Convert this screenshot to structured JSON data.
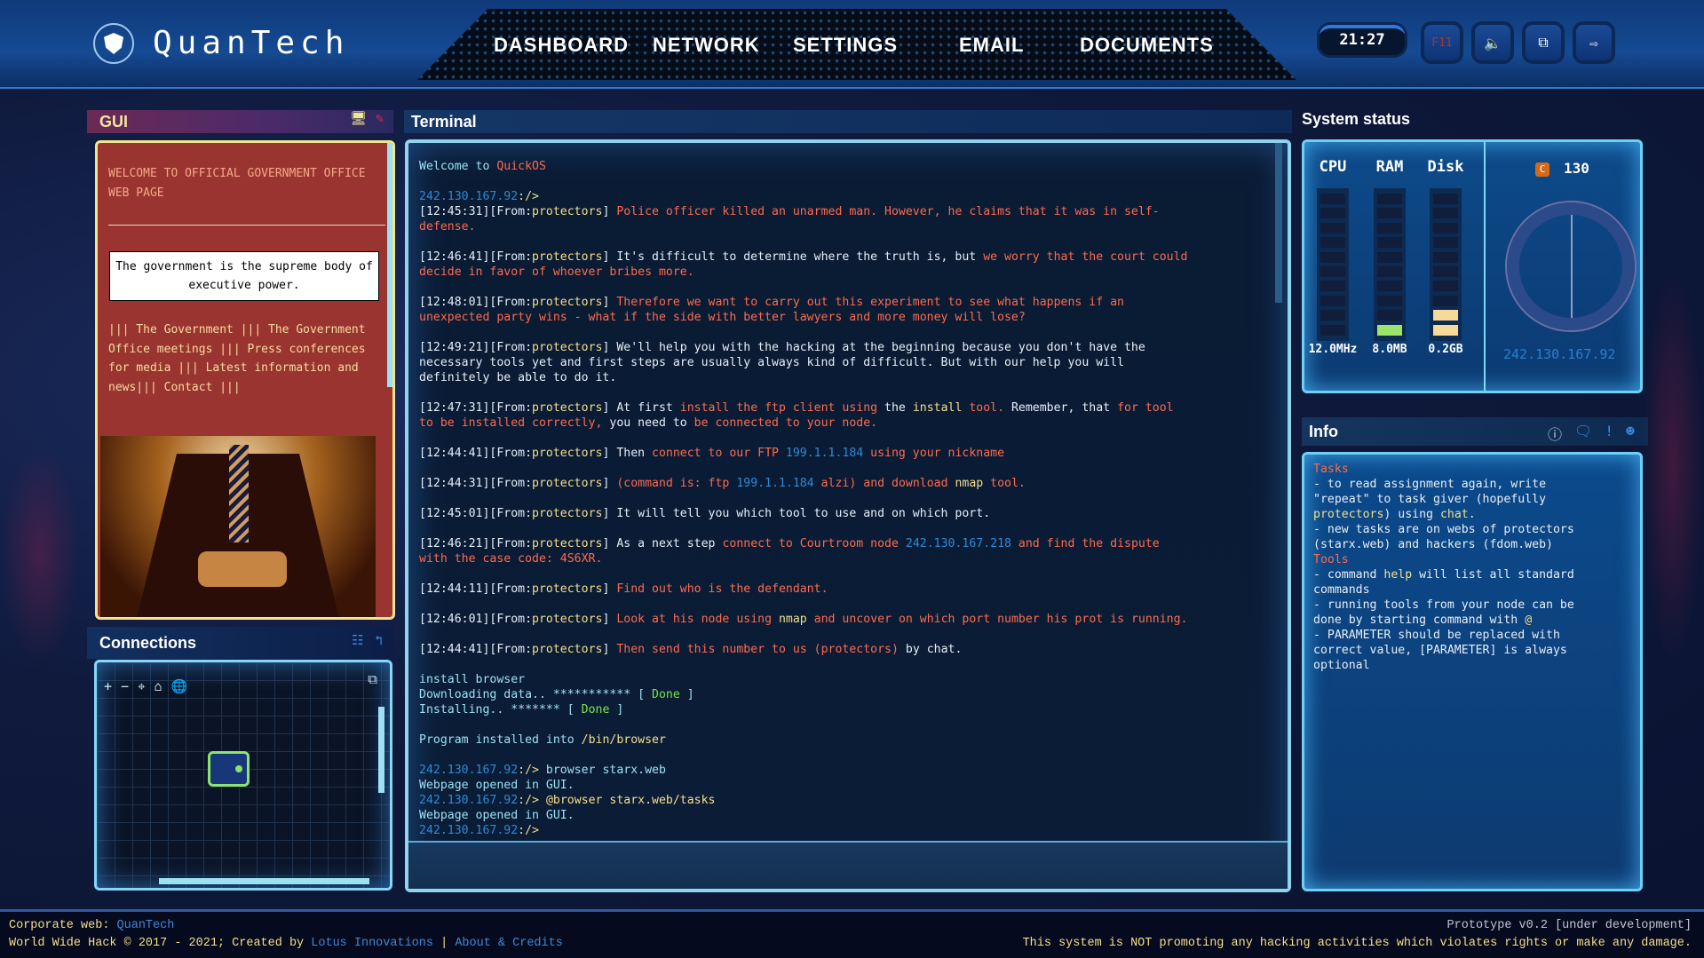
{
  "header": {
    "brand": "QuanTech",
    "nav": [
      "DASHBOARD",
      "NETWORK",
      "SETTINGS",
      "EMAIL",
      "DOCUMENTS"
    ],
    "clock": "21:27",
    "buttons": [
      {
        "name": "fullscreen",
        "label": "F11",
        "icon": "f11-key",
        "color": "#c23a2a"
      },
      {
        "name": "sound",
        "label": "",
        "icon": "speaker-icon"
      },
      {
        "name": "window",
        "label": "",
        "icon": "window-cursor-icon"
      },
      {
        "name": "logout",
        "label": "",
        "icon": "logout-icon"
      }
    ]
  },
  "gui": {
    "title": "GUI",
    "icons": [
      "monitor-icon",
      "edit-icon"
    ],
    "heading": "WELCOME TO OFFICIAL GOVERNMENT OFFICE WEB PAGE",
    "quote": "The government is the supreme body of executive power.",
    "links": "||| The Government ||| The Government Office meetings ||| Press conferences for media ||| Latest information and news||| Contact |||"
  },
  "connections": {
    "title": "Connections",
    "header_icons": [
      "network-tree-icon",
      "route-icon"
    ],
    "toolbar": [
      "+",
      "−",
      "locate-icon",
      "home-icon",
      "globe-icon"
    ],
    "expand_icon": "external-link-icon"
  },
  "terminal": {
    "title": "Terminal",
    "lines": [
      [
        [
          "c",
          "Welcome to "
        ],
        [
          "r",
          "QuickOS"
        ]
      ],
      [],
      [
        [
          "b",
          "242.130.167.92"
        ],
        [
          "y",
          ":/>"
        ]
      ],
      [
        [
          "w",
          "[12:45:31][From:"
        ],
        [
          "y",
          "protectors"
        ],
        [
          "w",
          "] "
        ],
        [
          "r",
          "Police officer killed an unarmed man. However, he claims that it was in self-"
        ]
      ],
      [
        [
          "r",
          "defense."
        ]
      ],
      [],
      [
        [
          "w",
          "[12:46:41][From:"
        ],
        [
          "y",
          "protectors"
        ],
        [
          "w",
          "] It's difficult to determine where the truth is, but "
        ],
        [
          "r",
          "we worry that the court could"
        ]
      ],
      [
        [
          "r",
          "decide in favor of whoever bribes more."
        ]
      ],
      [],
      [
        [
          "w",
          "[12:48:01][From:"
        ],
        [
          "y",
          "protectors"
        ],
        [
          "w",
          "] "
        ],
        [
          "r",
          "Therefore we want to carry out this experiment to see what happens if an"
        ]
      ],
      [
        [
          "r",
          "unexpected party wins - what if the side with better lawyers and more money will lose?"
        ]
      ],
      [],
      [
        [
          "w",
          "[12:49:21][From:"
        ],
        [
          "y",
          "protectors"
        ],
        [
          "w",
          "] We'll help you with the hacking at the beginning because you don't have the"
        ]
      ],
      [
        [
          "w",
          "necessary tools yet and first steps are usually always kind of difficult. But with our help you will"
        ]
      ],
      [
        [
          "w",
          "definitely be able to do it."
        ]
      ],
      [],
      [
        [
          "w",
          "[12:47:31][From:"
        ],
        [
          "y",
          "protectors"
        ],
        [
          "w",
          "] At first "
        ],
        [
          "r",
          "install the ftp client using"
        ],
        [
          "w",
          " the "
        ],
        [
          "y",
          "install"
        ],
        [
          "r",
          " tool."
        ],
        [
          "w",
          " Remember, that "
        ],
        [
          "r",
          "for tool"
        ]
      ],
      [
        [
          "r",
          "to be installed correctly,"
        ],
        [
          "w",
          " you need to "
        ],
        [
          "r",
          "be connected to your node."
        ]
      ],
      [],
      [
        [
          "w",
          "[12:44:41][From:"
        ],
        [
          "y",
          "protectors"
        ],
        [
          "w",
          "] Then "
        ],
        [
          "r",
          "connect to our FTP "
        ],
        [
          "b",
          "199.1.1.184"
        ],
        [
          "r",
          " using your nickname"
        ]
      ],
      [],
      [
        [
          "w",
          "[12:44:31][From:"
        ],
        [
          "y",
          "protectors"
        ],
        [
          "w",
          "] "
        ],
        [
          "r",
          "(command is: ftp "
        ],
        [
          "b",
          "199.1.1.184"
        ],
        [
          "r",
          " alzi) and download "
        ],
        [
          "y",
          "nmap"
        ],
        [
          "r",
          " tool."
        ]
      ],
      [],
      [
        [
          "w",
          "[12:45:01][From:"
        ],
        [
          "y",
          "protectors"
        ],
        [
          "w",
          "] It will tell you which tool to use and on which port."
        ]
      ],
      [],
      [
        [
          "w",
          "[12:46:21][From:"
        ],
        [
          "y",
          "protectors"
        ],
        [
          "w",
          "] As a next step "
        ],
        [
          "r",
          "connect to Courtroom node "
        ],
        [
          "b",
          "242.130.167.218"
        ],
        [
          "r",
          " and find the dispute"
        ]
      ],
      [
        [
          "r",
          "with the case code: 4S6XR."
        ]
      ],
      [],
      [
        [
          "w",
          "[12:44:11][From:"
        ],
        [
          "y",
          "protectors"
        ],
        [
          "w",
          "] "
        ],
        [
          "r",
          "Find out who is the defendant."
        ]
      ],
      [],
      [
        [
          "w",
          "[12:46:01][From:"
        ],
        [
          "y",
          "protectors"
        ],
        [
          "w",
          "] "
        ],
        [
          "r",
          "Look at his node using "
        ],
        [
          "y",
          "nmap"
        ],
        [
          "r",
          " and uncover on which port number his prot is running."
        ]
      ],
      [],
      [
        [
          "w",
          "[12:44:41][From:"
        ],
        [
          "y",
          "protectors"
        ],
        [
          "w",
          "] "
        ],
        [
          "r",
          "Then send this number to us (protectors)"
        ],
        [
          "w",
          " by chat."
        ]
      ],
      [],
      [
        [
          "c",
          "install browser"
        ]
      ],
      [
        [
          "c",
          "Downloading data.. *********** [ "
        ],
        [
          "g",
          "Done"
        ],
        [
          "c",
          " ]"
        ]
      ],
      [
        [
          "c",
          "Installing.. ******* [ "
        ],
        [
          "g",
          "Done"
        ],
        [
          "c",
          " ]"
        ]
      ],
      [],
      [
        [
          "c",
          "Program installed into "
        ],
        [
          "y",
          "/bin/browser"
        ]
      ],
      [],
      [
        [
          "b",
          "242.130.167.92"
        ],
        [
          "y",
          ":/>"
        ],
        [
          "c",
          " browser starx.web"
        ]
      ],
      [
        [
          "c",
          "Webpage opened in GUI."
        ]
      ],
      [
        [
          "b",
          "242.130.167.92"
        ],
        [
          "y",
          ":/>"
        ],
        [
          "c",
          " "
        ],
        [
          "y",
          "@browser starx.web/tasks"
        ]
      ],
      [
        [
          "c",
          "Webpage opened in GUI."
        ]
      ],
      [
        [
          "b",
          "242.130.167.92"
        ],
        [
          "y",
          ":/>"
        ]
      ]
    ],
    "input_value": ""
  },
  "system_status": {
    "title": "System status",
    "meters": [
      {
        "label": "CPU",
        "value": "12.0MHz",
        "level": 0.0,
        "color": "#101e3b"
      },
      {
        "label": "RAM",
        "value": "8.0MB",
        "level": 0.1,
        "color": "#9be36a"
      },
      {
        "label": "Disk",
        "value": "0.2GB",
        "level": 0.2,
        "color": "#f7d99a"
      }
    ],
    "credits": "130",
    "credits_icon": "C",
    "ip": "242.130.167.92"
  },
  "info": {
    "title": "Info",
    "icons": [
      "info-icon",
      "chat-icon",
      "alert-icon",
      "user-icon"
    ],
    "lines": [
      [
        [
          "r",
          "Tasks"
        ]
      ],
      [
        [
          "w",
          "- to read assignment again, write"
        ]
      ],
      [
        [
          "w",
          "\"repeat\" to task giver (hopefully"
        ]
      ],
      [
        [
          "y",
          "protectors"
        ],
        [
          "w",
          ") using "
        ],
        [
          "y",
          "chat"
        ],
        [
          "w",
          "."
        ]
      ],
      [
        [
          "w",
          "- new tasks are on webs of protectors"
        ]
      ],
      [
        [
          "w",
          "(starx.web) and hackers (fdom.web)"
        ]
      ],
      [],
      [
        [
          "r",
          "Tools"
        ]
      ],
      [
        [
          "w",
          "- command "
        ],
        [
          "y",
          "help"
        ],
        [
          "w",
          " will list all standard"
        ]
      ],
      [
        [
          "w",
          "commands"
        ]
      ],
      [
        [
          "w",
          "- running tools from your node can be"
        ]
      ],
      [
        [
          "w",
          "done by starting command with "
        ],
        [
          "y",
          "@"
        ]
      ],
      [
        [
          "w",
          "- PARAMETER should be replaced with"
        ]
      ],
      [
        [
          "w",
          "correct value, [PARAMETER] is always"
        ]
      ],
      [
        [
          "w",
          "optional"
        ]
      ]
    ]
  },
  "footer": {
    "corporate_label": "Corporate web: ",
    "corporate_link": "QuanTech",
    "copyright": "World Wide Hack © 2017 - 2021; Created by ",
    "creator_link": "Lotus Innovations",
    "separator": " | ",
    "credits_link": "About & Credits",
    "version": "Prototype v0.2 [under development]",
    "disclaimer": "This system is NOT promoting any hacking activities which violates rights or make any damage."
  }
}
